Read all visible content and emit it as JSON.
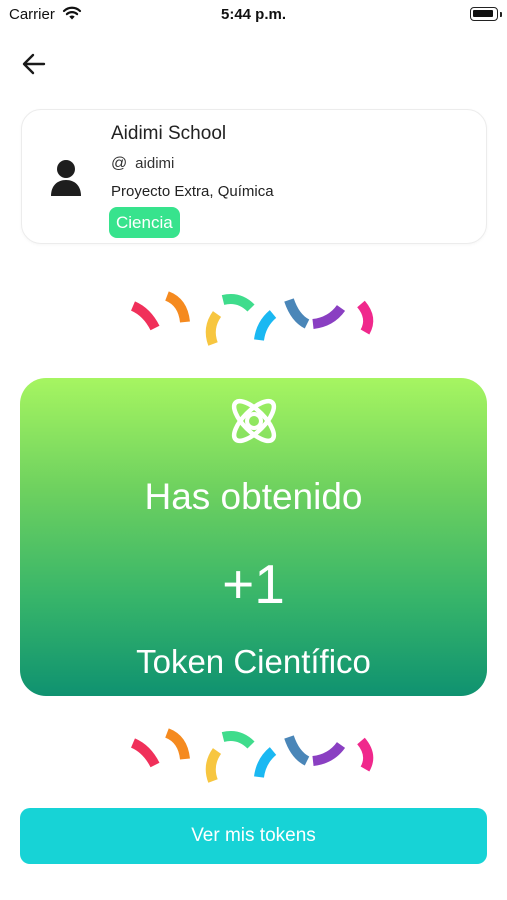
{
  "status_bar": {
    "carrier": "Carrier",
    "time": "5:44 p.m."
  },
  "nav": {
    "back_icon": "arrow-left-icon"
  },
  "profile": {
    "name": "Aidimi School",
    "at_symbol": "@",
    "handle": "aidimi",
    "project": "Proyecto Extra, Química",
    "category": "Ciencia",
    "category_color": "#37e38d"
  },
  "reward": {
    "title": "Has obtenido",
    "amount": "+1",
    "token": "Token Científico",
    "icon": "atom-icon",
    "gradient": [
      "#a6f561",
      "#0f9270"
    ]
  },
  "actions": {
    "view_tokens": "Ver mis tokens",
    "button_color": "#17d3d6"
  },
  "confetti_colors": [
    "#f0305a",
    "#f58a1f",
    "#f7c640",
    "#3fdc8c",
    "#1ab8f2",
    "#4a86b8",
    "#8a3fc2",
    "#f0288c"
  ]
}
